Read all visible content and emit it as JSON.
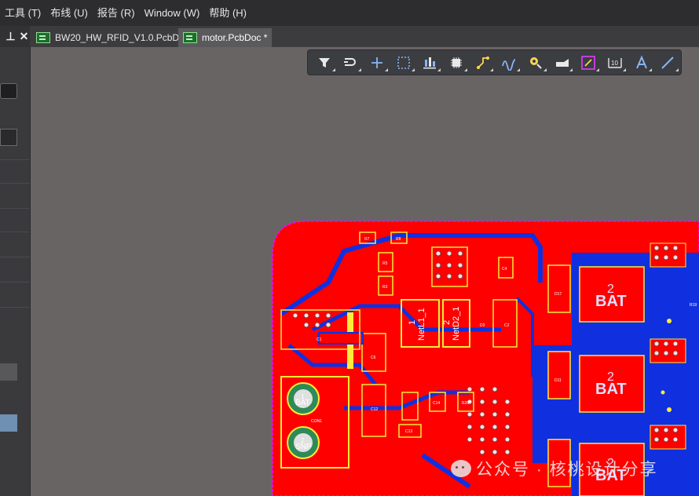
{
  "menubar": {
    "items": [
      {
        "label": "工具 (T)"
      },
      {
        "label": "布线 (U)"
      },
      {
        "label": "报告 (R)"
      },
      {
        "label": "Window (W)"
      },
      {
        "label": "帮助 (H)"
      }
    ]
  },
  "tabs": [
    {
      "label": "BW20_HW_RFID_V1.0.PcbDoc",
      "active": false
    },
    {
      "label": "motor.PcbDoc *",
      "active": true
    }
  ],
  "toolbar": {
    "tools": [
      "filter-icon",
      "interactive-route-icon",
      "cross-icon",
      "select-rect-icon",
      "align-icon",
      "component-icon",
      "route-icon",
      "diff-pair-icon",
      "via-icon",
      "polygon-icon",
      "net-color-icon",
      "dimension-icon",
      "text-icon",
      "line-icon"
    ]
  },
  "pcb": {
    "labels": {
      "bat1": "BAT",
      "bat2": "BAT",
      "bat3": "BAT",
      "pad_a": "BAT",
      "pad_b": "SNP",
      "net_l1": "NetL1_1",
      "net_d2": "NetD2_1",
      "pin1": "1",
      "pin2": "2",
      "pad1": "1",
      "pad2": "2",
      "num2a": "2",
      "num2b": "2",
      "num2c": "2",
      "ref_r7": "R7",
      "ref_r8": "R8",
      "ref_r5": "R5",
      "ref_r3": "R3",
      "ref_c4": "C4",
      "ref_d2": "D2",
      "ref_c2": "C2",
      "ref_c1": "C1",
      "ref_c6": "C6",
      "ref_c12": "C12",
      "ref_c13": "C13",
      "ref_c14": "C14",
      "ref_r20": "R20",
      "ref_d17": "D17",
      "ref_d11": "D11",
      "ref_r19": "R19",
      "ref_cn1": "CON1"
    }
  },
  "watermark": {
    "text": "公众号 · 核桃设计分享"
  }
}
